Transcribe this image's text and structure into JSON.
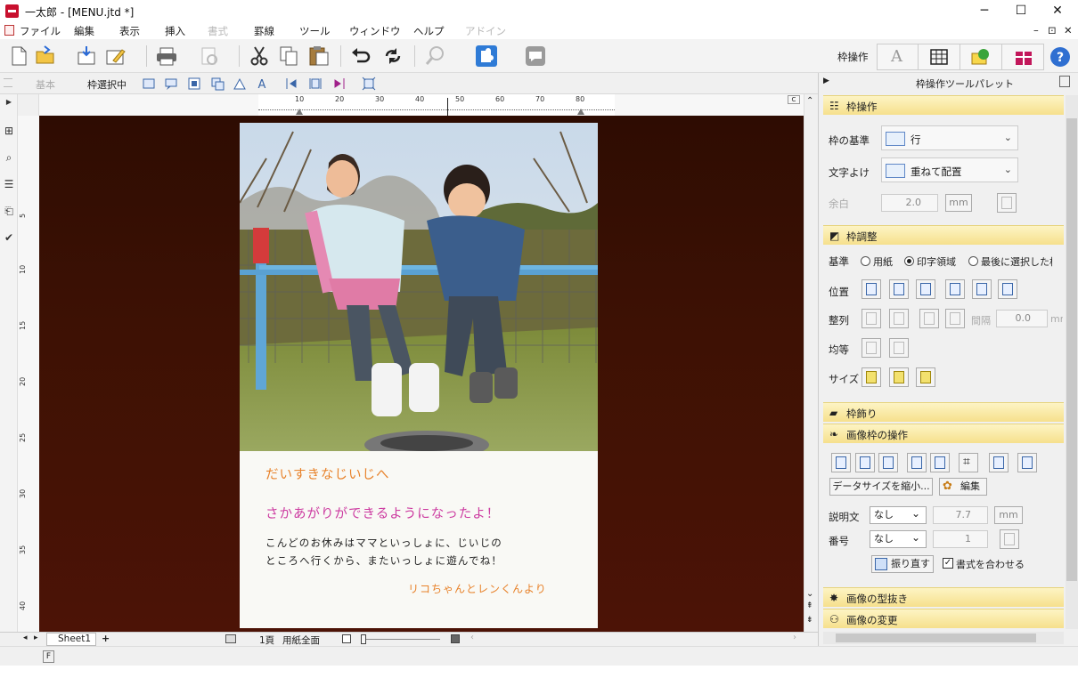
{
  "window": {
    "title": "一太郎 - [MENU.jtd *]",
    "minimize": "─",
    "maximize": "☐",
    "close": "✕"
  },
  "menu": {
    "items": [
      "ファイル",
      "編集",
      "表示",
      "挿入",
      "書式",
      "罫線",
      "ツール",
      "ウィンドウ",
      "ヘルプ",
      "アドイン"
    ],
    "disabled": [
      4,
      9
    ],
    "mdi_controls": [
      "–",
      "⊡",
      "✕"
    ]
  },
  "toolbar": {
    "waku_label": "枠操作",
    "icons": [
      "new-document-icon",
      "open-folder-icon",
      "save-icon",
      "save-as-icon",
      "print-icon",
      "print-preview-icon",
      "cut-icon",
      "copy-icon",
      "paste-icon",
      "undo-icon",
      "redo-icon",
      "search-icon",
      "jigsaw-icon",
      "comment-icon"
    ],
    "right_icons": [
      "text-a-icon",
      "table-grid-icon",
      "image-tree-icon",
      "gift-icon",
      "help-icon"
    ]
  },
  "toolbar2": {
    "basic": "基本",
    "selecting": "枠選択中"
  },
  "ruler": {
    "h_ticks": [
      "10",
      "20",
      "30",
      "40",
      "50",
      "60",
      "70",
      "80"
    ],
    "v_ticks": [
      "5",
      "10",
      "15",
      "20",
      "25",
      "30",
      "35",
      "40"
    ],
    "corner": "C"
  },
  "document": {
    "line1": "だいすきなじいじへ",
    "line2": "さかあがりができるようになったよ！",
    "line3": "こんどのお休みはママといっしょに、じいじの",
    "line4": "ところへ行くから、またいっしょに遊んでね！",
    "signature": "リコちゃんとレンくんより",
    "colors": {
      "line1": "#e8822a",
      "line2": "#cc3aa0",
      "body": "#222222",
      "signature": "#e8822a"
    }
  },
  "statusbar": {
    "sheet": "Sheet1",
    "page": "1頁",
    "paper": "用紙全面",
    "mode": "F"
  },
  "panel": {
    "title": "枠操作ツールパレット",
    "sections": {
      "waku_sousa": "枠操作",
      "waku_chousei": "枠調整",
      "waku_kazari": "枠飾り",
      "image_sousa": "画像枠の操作",
      "image_nuki": "画像の型抜き",
      "image_henkou": "画像の変更"
    },
    "kijun_label": "枠の基準",
    "kijun_value": "行",
    "moji_label": "文字よけ",
    "moji_value": "重ねて配置",
    "yohaku_label": "余白",
    "yohaku_value": "2.0",
    "unit_mm": "mm",
    "base_label": "基準",
    "base_options": [
      "用紙",
      "印字領域",
      "最後に選択した枠"
    ],
    "base_selected": 1,
    "ichi_label": "位置",
    "seiretsu_label": "整列",
    "kankaku_label": "間隔",
    "kankaku_value": "0.0",
    "kankaku_unit": "mm",
    "kintou_label": "均等",
    "size_label": "サイズ",
    "data_shrink_btn": "データサイズを縮小...",
    "edit_btn": "編集",
    "setsumei_label": "説明文",
    "setsumei_value": "なし",
    "setsumei_num": "7.7",
    "bangou_label": "番号",
    "bangou_value": "なし",
    "bangou_num": "1",
    "furinaoshi_btn": "振り直す",
    "match_format": "書式を合わせる",
    "match_checked": true
  }
}
